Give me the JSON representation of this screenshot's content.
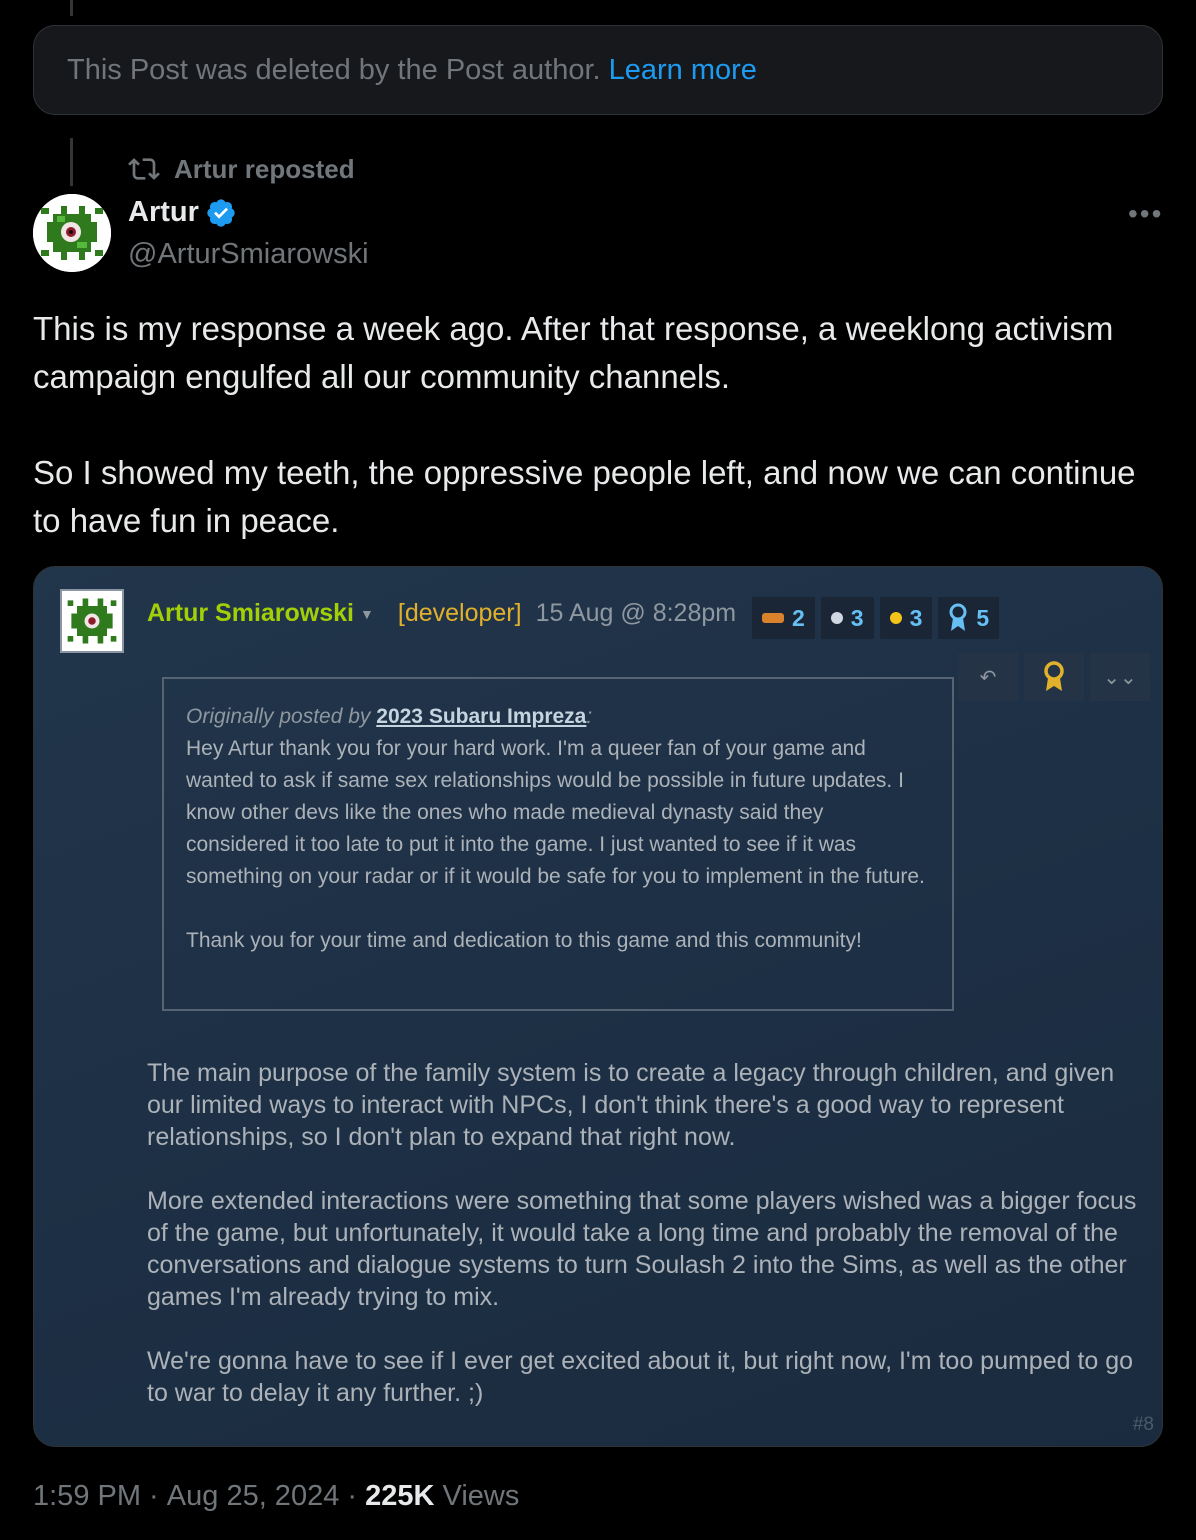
{
  "deleted_notice": {
    "text": "This Post was deleted by the Post author.",
    "link": "Learn more"
  },
  "repost": {
    "label": "Artur reposted",
    "icon": "repost-icon"
  },
  "author": {
    "name": "Artur",
    "handle": "@ArturSmiarowski",
    "verified_icon": "verified-badge-icon"
  },
  "post": {
    "text": "This is my response a week ago. After that response, a weeklong activism campaign engulfed all our community channels.\n\nSo I showed my teeth, the oppressive people left, and now we can continue to have fun in peace."
  },
  "embedded_screenshot": {
    "username": "Artur Smiarowski",
    "role": "[developer]",
    "date": "15 Aug @ 8:28pm",
    "awards": [
      {
        "icon": "hand-award-icon",
        "count": "2",
        "color": "#d9822b"
      },
      {
        "icon": "bubble-award-icon",
        "count": "3",
        "color": "#cfd8e3"
      },
      {
        "icon": "sun-award-icon",
        "count": "3",
        "color": "#f2c318"
      },
      {
        "icon": "ribbon-award-icon",
        "count": "5",
        "color": "#66c0f4"
      }
    ],
    "quote": {
      "prefix": "Originally posted by ",
      "quoted_user": "2023 Subaru Impreza",
      "suffix": ":",
      "body": "Hey Artur thank you for your hard work. I'm a queer fan of your game and wanted to ask if same sex relationships would be possible in future updates. I know other devs like the ones who made medieval dynasty said they considered it too late to put it into the game. I just wanted to see if it was something on your radar or if it would be safe for you to implement in the future.\n\nThank you for your time and dedication to this game and this community!"
    },
    "reply": "The main purpose of the family system is to create a legacy through children, and given our limited ways to interact with NPCs, I don't think there's a good way to represent relationships, so I don't plan to expand that right now.\n\nMore extended interactions were something that some players wished was a bigger focus of the game, but unfortunately, it would take a long time and probably the removal of the conversations and dialogue systems to turn Soulash 2 into the Sims, as well as the other games I'm already trying to mix.\n\nWe're gonna have to see if I ever get excited about it, but right now, I'm too pumped to go to war to delay it any further. ;)",
    "post_number": "#8"
  },
  "meta": {
    "time": "1:59 PM",
    "separator": " · ",
    "date": "Aug 25, 2024",
    "views_count": "225K",
    "views_label": " Views"
  }
}
